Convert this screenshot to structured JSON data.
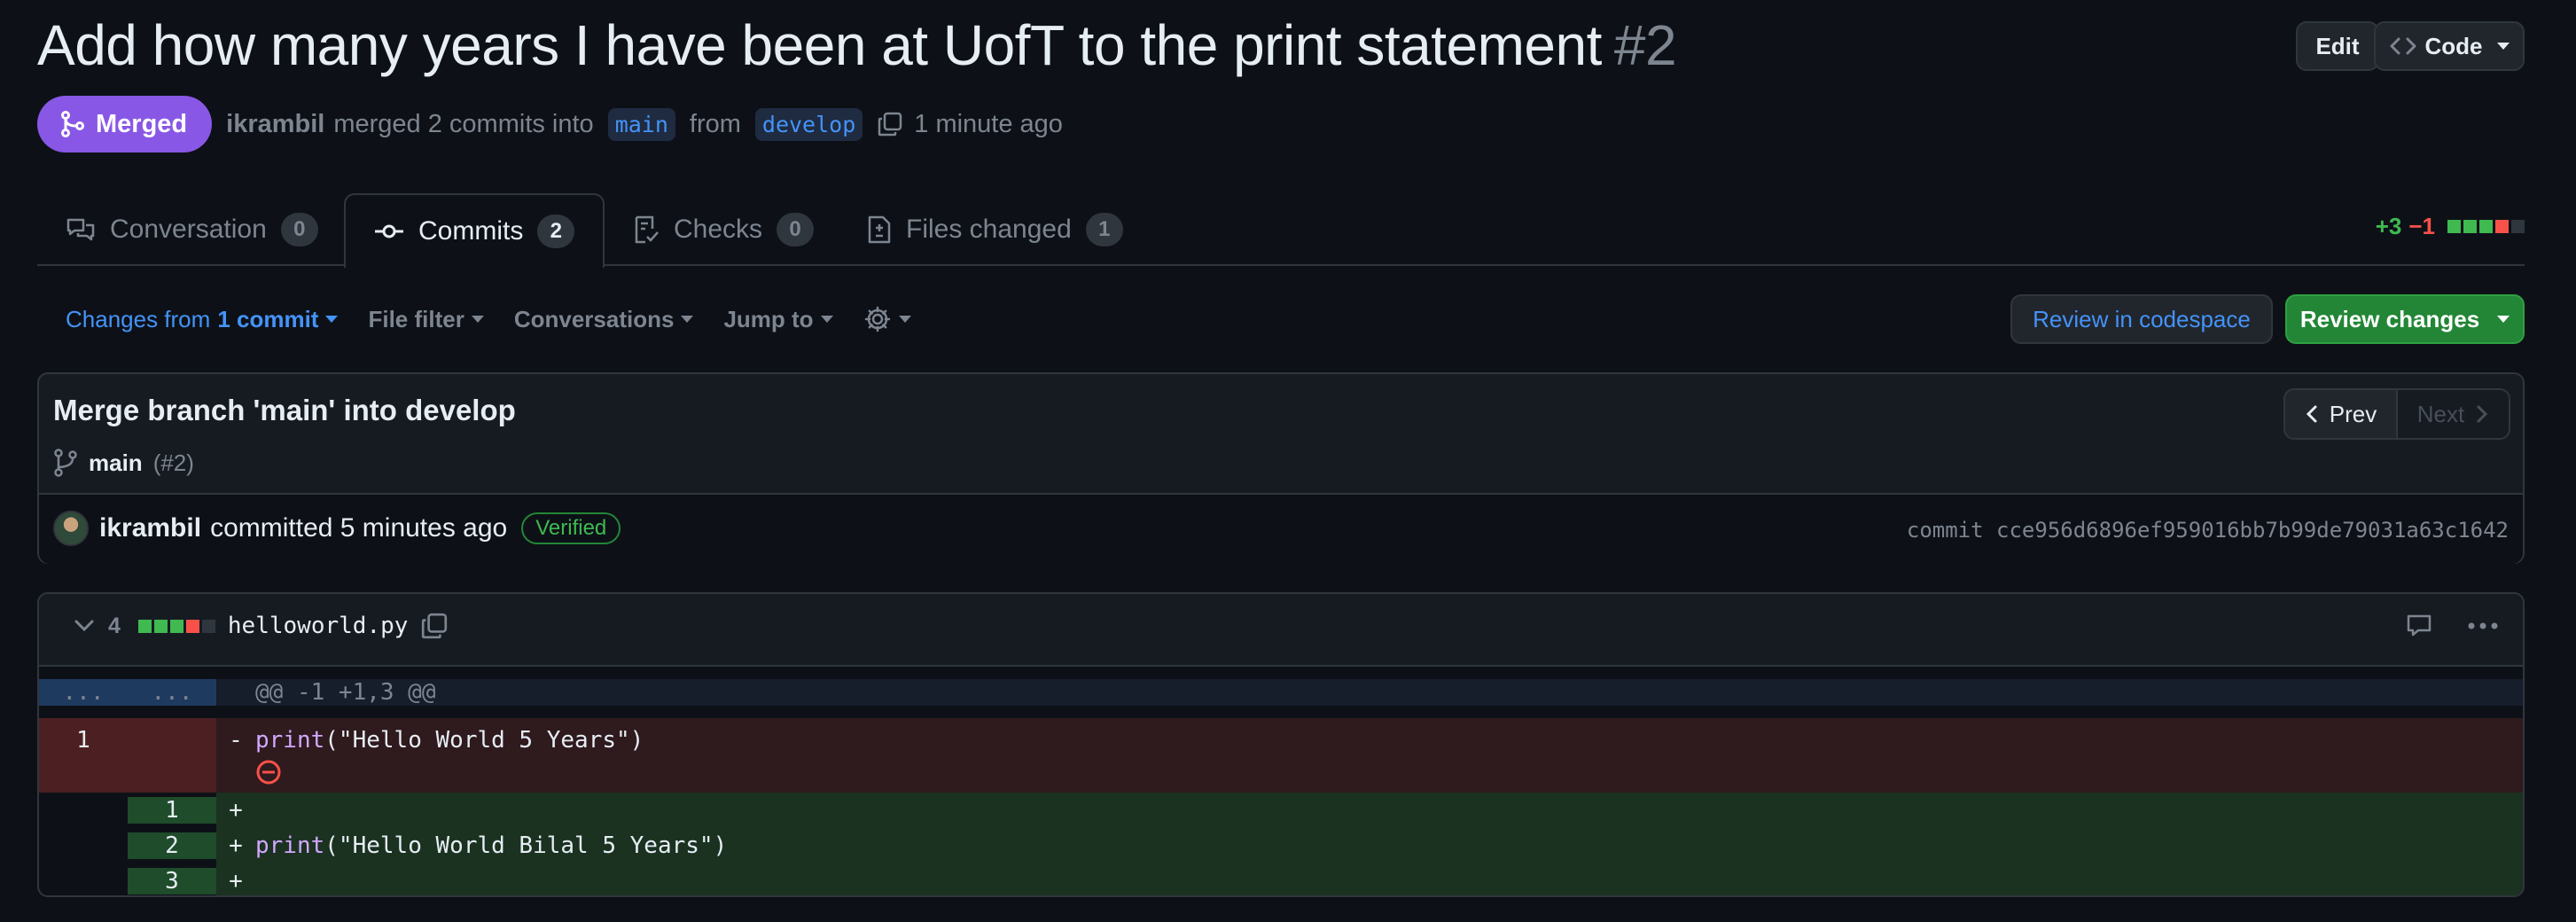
{
  "pr": {
    "title": "Add how many years I have been at UofT to the print statement",
    "number": "#2",
    "status": "Merged",
    "author": "ikrambil",
    "merge_text": "merged 2 commits into",
    "base_branch": "main",
    "from_text": "from",
    "head_branch": "develop",
    "time": "1 minute ago"
  },
  "header_buttons": {
    "edit": "Edit",
    "code": "Code"
  },
  "tabs": [
    {
      "label": "Conversation",
      "count": "0",
      "icon": "comment-discussion-icon"
    },
    {
      "label": "Commits",
      "count": "2",
      "icon": "git-commit-icon",
      "active": true
    },
    {
      "label": "Checks",
      "count": "0",
      "icon": "checklist-icon"
    },
    {
      "label": "Files changed",
      "count": "1",
      "icon": "file-diff-icon"
    }
  ],
  "diffstat": {
    "additions": "+3",
    "deletions": "−1",
    "blocks": [
      "add",
      "add",
      "add",
      "del",
      "neutral"
    ]
  },
  "toolbar": {
    "changes_prefix": "Changes from",
    "changes_bold": "1 commit",
    "file_filter": "File filter",
    "conversations": "Conversations",
    "jump_to": "Jump to",
    "review_codespace": "Review in codespace",
    "review_changes": "Review changes"
  },
  "commit": {
    "title": "Merge branch 'main' into develop",
    "branch": "main",
    "pr_ref": "(#2)",
    "prev": "Prev",
    "next": "Next",
    "author": "ikrambil",
    "committed_text": "committed 5 minutes ago",
    "verified": "Verified",
    "sha_label": "commit cce956d6896ef959016bb7b99de79031a63c1642"
  },
  "file": {
    "changes": "4",
    "blocks": [
      "add",
      "add",
      "add",
      "del",
      "neutral"
    ],
    "name": "helloworld.py",
    "hunk": "@@ -1 +1,3 @@",
    "hunk_dots_left": "...",
    "hunk_dots_right": "...",
    "lines": [
      {
        "type": "del",
        "old": "1",
        "new": "",
        "sign": "-",
        "fn": "print",
        "rest": "(\"Hello World 5 Years\")"
      },
      {
        "type": "add",
        "old": "",
        "new": "1",
        "sign": "+",
        "fn": "",
        "rest": ""
      },
      {
        "type": "add",
        "old": "",
        "new": "2",
        "sign": "+",
        "fn": "print",
        "rest": "(\"Hello World Bilal 5 Years\")"
      },
      {
        "type": "add",
        "old": "",
        "new": "3",
        "sign": "+",
        "fn": "",
        "rest": ""
      }
    ]
  },
  "colors": {
    "background": "#0d1117",
    "merged": "#8957e5",
    "add": "#3fb950",
    "del": "#f85149",
    "link": "#4493f8",
    "primary_button": "#238636"
  }
}
